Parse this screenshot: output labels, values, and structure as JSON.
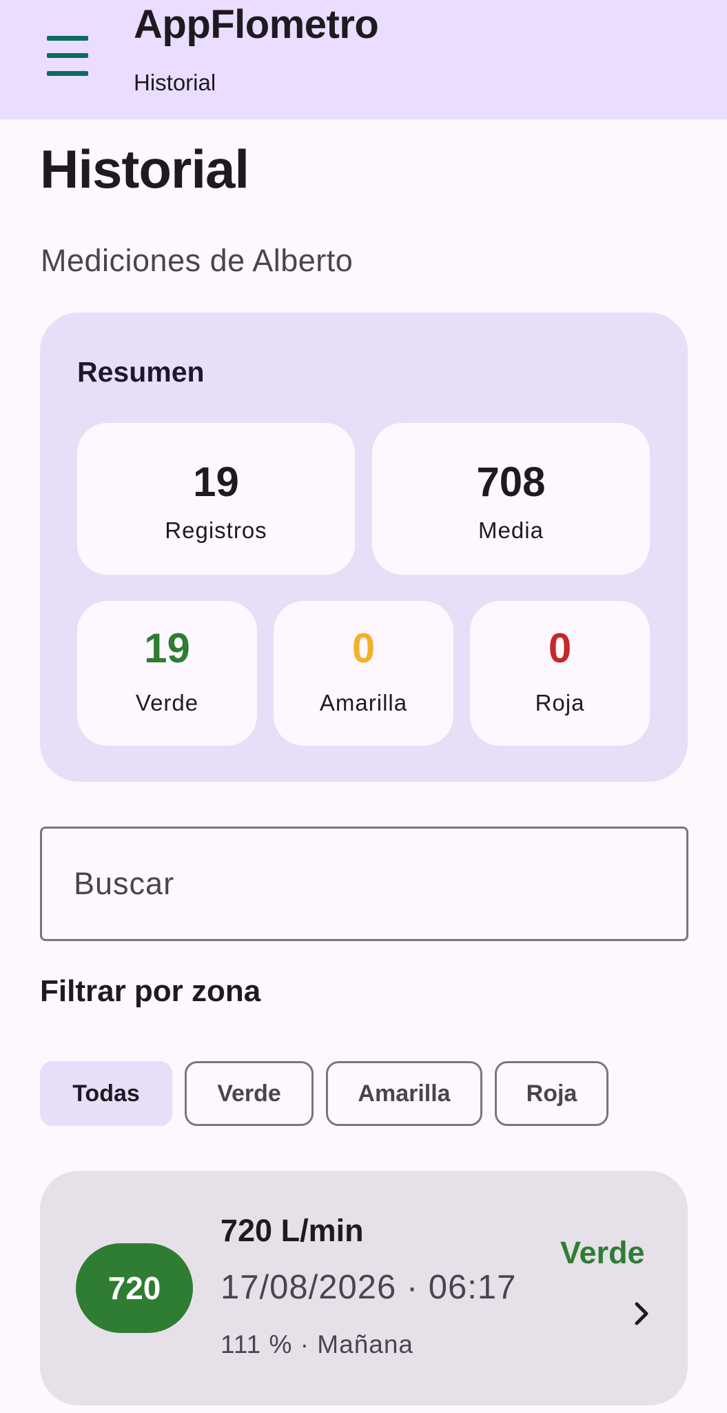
{
  "app": {
    "title": "AppFlometro",
    "subtitle": "Historial"
  },
  "page": {
    "title": "Historial",
    "subtitle": "Mediciones de Alberto"
  },
  "summary": {
    "title": "Resumen",
    "registros": {
      "value": "19",
      "label": "Registros"
    },
    "media": {
      "value": "708",
      "label": "Media"
    },
    "verde": {
      "value": "19",
      "label": "Verde",
      "color": "#2e7d32"
    },
    "amarilla": {
      "value": "0",
      "label": "Amarilla",
      "color": "#f3b02c"
    },
    "roja": {
      "value": "0",
      "label": "Roja",
      "color": "#c62828"
    }
  },
  "search": {
    "placeholder": "Buscar"
  },
  "filter": {
    "title": "Filtrar por zona",
    "chips": [
      {
        "label": "Todas",
        "selected": true
      },
      {
        "label": "Verde",
        "selected": false
      },
      {
        "label": "Amarilla",
        "selected": false
      },
      {
        "label": "Roja",
        "selected": false
      }
    ]
  },
  "records": [
    {
      "badge": "720",
      "value": "720 L/min",
      "datetime": "17/08/2026 · 06:17",
      "meta": "111 % · Mañana",
      "zone": "Verde",
      "zone_color": "#2e7d32",
      "icons": {
        "chevron": "chevron-right-icon",
        "menu": "menu-icon"
      }
    }
  ]
}
